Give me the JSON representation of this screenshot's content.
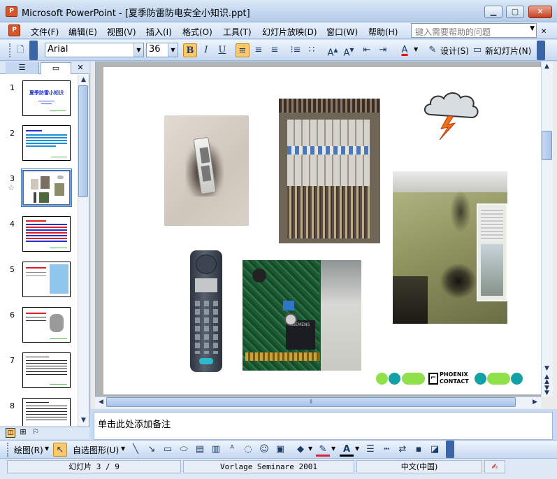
{
  "window": {
    "title": "Microsoft PowerPoint - [夏季防雷防电安全小知识.ppt]",
    "app_icon": "P",
    "minimize": "▁",
    "restore": "▢",
    "close": "✕"
  },
  "menu": {
    "doc_icon": "P",
    "items": [
      "文件(F)",
      "编辑(E)",
      "视图(V)",
      "插入(I)",
      "格式(O)",
      "工具(T)",
      "幻灯片放映(D)",
      "窗口(W)",
      "帮助(H)"
    ],
    "help_placeholder": "键入需要帮助的问题"
  },
  "format_toolbar": {
    "font_name": "Arial",
    "font_size": "36",
    "bold": "B",
    "italic": "I",
    "underline": "U",
    "design_label": "设计(S)",
    "new_slide_label": "新幻灯片(N)"
  },
  "slides_pane": {
    "tab_outline": "☰",
    "tab_slides": "▭",
    "close": "✕",
    "slide_numbers": [
      "1",
      "2",
      "3",
      "4",
      "5",
      "6",
      "7",
      "8"
    ],
    "selected": "3",
    "slide1_title": "夏季防雷小知识",
    "star": "☆"
  },
  "slide": {
    "logo_text_1": "PHOENIX",
    "logo_text_2": "CONTACT",
    "pcb_chip_label": "SIEMENS"
  },
  "notes": {
    "placeholder": "单击此处添加备注"
  },
  "draw_toolbar": {
    "draw_label": "绘图(R)",
    "autoshapes_label": "自选图形(U)"
  },
  "status": {
    "slide_info": "幻灯片 3 / 9",
    "template": "Vorlage Seminare 2001",
    "language": "中文(中国)"
  },
  "colors": {
    "accent": "#3e6fb4",
    "chrome": "#c9daf2",
    "logo_green": "#8fe04a",
    "logo_teal": "#13a1a6"
  }
}
